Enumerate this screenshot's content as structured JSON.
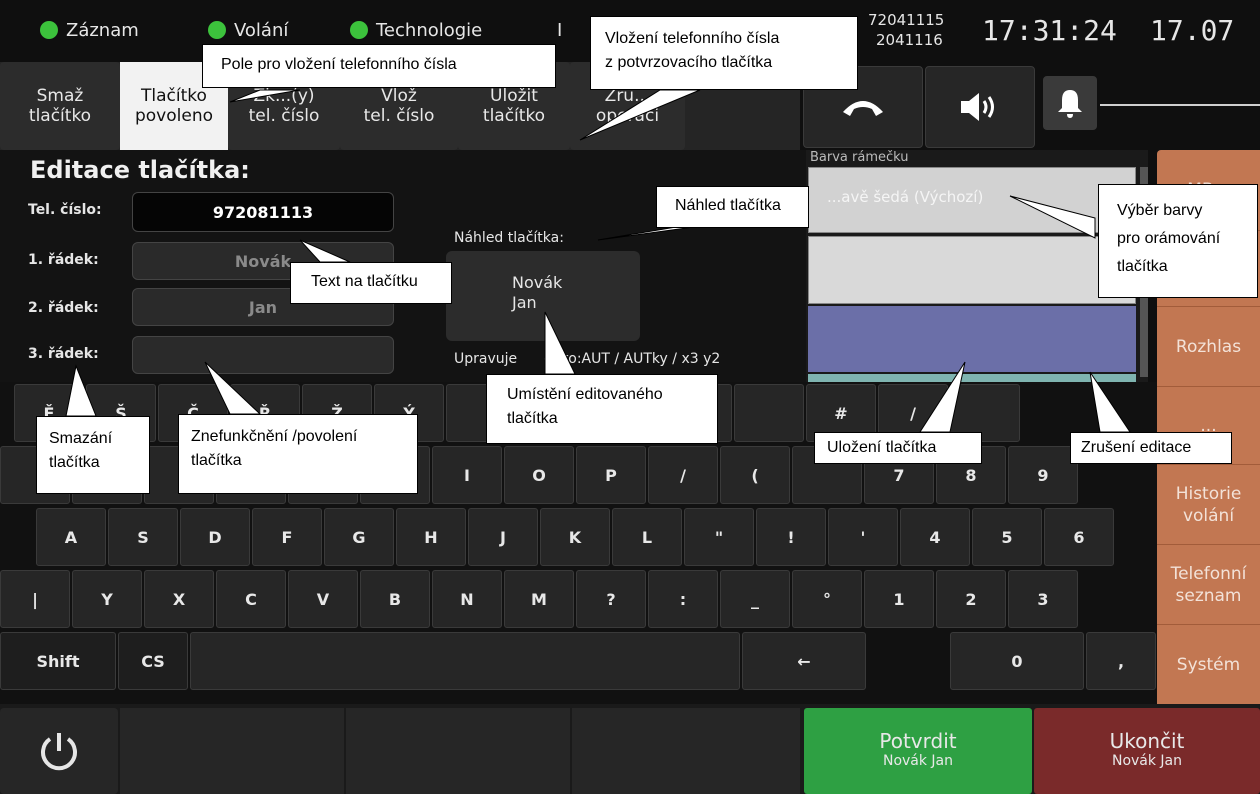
{
  "status": {
    "items": [
      "Záznam",
      "Volání",
      "Technologie"
    ],
    "hidden_item_initial": "I",
    "numbers": [
      "72041115",
      "2041116"
    ],
    "time": "17:31:24",
    "date": "17.07"
  },
  "toolbar": {
    "buttons": [
      {
        "line1": "Smaž",
        "line2": "tlačítko"
      },
      {
        "line1": "Tlačítko",
        "line2": "povoleno"
      },
      {
        "line1": "Zk...(y)",
        "line2": "tel. číslo"
      },
      {
        "line1": "Vlož",
        "line2": "tel. číslo"
      },
      {
        "line1": "Uložit",
        "line2": "tlačítko"
      },
      {
        "line1": "Zru...",
        "line2": "operaci"
      }
    ]
  },
  "editor": {
    "title": "Editace tlačítka:",
    "phone_label": "Tel. číslo:",
    "phone_value": "972081113",
    "row1_label": "1. řádek:",
    "row1_value": "Novák",
    "row2_label": "2. řádek:",
    "row2_value": "Jan",
    "row3_label": "3. řádek:",
    "row3_value": "",
    "preview_label": "Náhled tlačítka:",
    "preview_line1": "Novák",
    "preview_line2": "Jan",
    "location_prefix": "Upravuje",
    "location_value": "čítko:AUT / AUTky / x3 y2"
  },
  "colors": {
    "header": "Barva rámečku",
    "options": [
      "...avě šedá (Výchozí)",
      "",
      "",
      ""
    ],
    "swatches": [
      "#d2d2d2",
      "#d9d9d9",
      "#6b6fa8",
      "#7fb4b0"
    ]
  },
  "keyboard": {
    "row0": [
      "Ě",
      "Š",
      "Č",
      "Ř",
      "Ž",
      "Ý",
      "",
      "",
      "%",
      "ˇ",
      "",
      "#",
      "/",
      ""
    ],
    "row1": [
      "",
      "",
      "",
      "",
      "",
      "U",
      "I",
      "O",
      "P",
      "/",
      "(",
      "",
      "7",
      "8",
      "9"
    ],
    "row2": [
      "A",
      "S",
      "D",
      "F",
      "G",
      "H",
      "J",
      "K",
      "L",
      "\"",
      "!",
      "'",
      "4",
      "5",
      "6"
    ],
    "row3": [
      "|",
      "Y",
      "X",
      "C",
      "V",
      "B",
      "N",
      "M",
      "?",
      ":",
      "_",
      "°",
      "1",
      "2",
      "3"
    ],
    "shift": "Shift",
    "cs": "CS",
    "arrow": "←",
    "zero": "0",
    "comma": ","
  },
  "sidebar": [
    "MB...",
    "Rozhlas",
    "...",
    "Historie volání",
    "Telefonní seznam",
    "Systém"
  ],
  "footer": {
    "confirm": "Potvrdit",
    "confirm_sub": "Novák Jan",
    "end": "Ukončit",
    "end_sub": "Novák Jan"
  },
  "callouts": {
    "phone_field": "Pole pro vložení telefonního čísla",
    "insert_from_button_1": "Vložení telefonního čísla",
    "insert_from_button_2": "z potvrzovacího tlačítka",
    "preview": "Náhled tlačítka",
    "text_on_button": "Text na tlačítku",
    "frame_color_1": "Výběr barvy",
    "frame_color_2": "pro orámování",
    "frame_color_3": "tlačítka",
    "location_1": "Umístění editovaného",
    "location_2": "tlačítka",
    "delete_1": "Smazání",
    "delete_2": "tlačítka",
    "disable_1": "Znefunkčnění /povolení",
    "disable_2": "tlačítka",
    "save": "Uložení tlačítka",
    "cancel": "Zrušení editace"
  },
  "accent_colors": {
    "green": "#2ea043",
    "red": "#7a2a2a",
    "side": "#c27752"
  }
}
